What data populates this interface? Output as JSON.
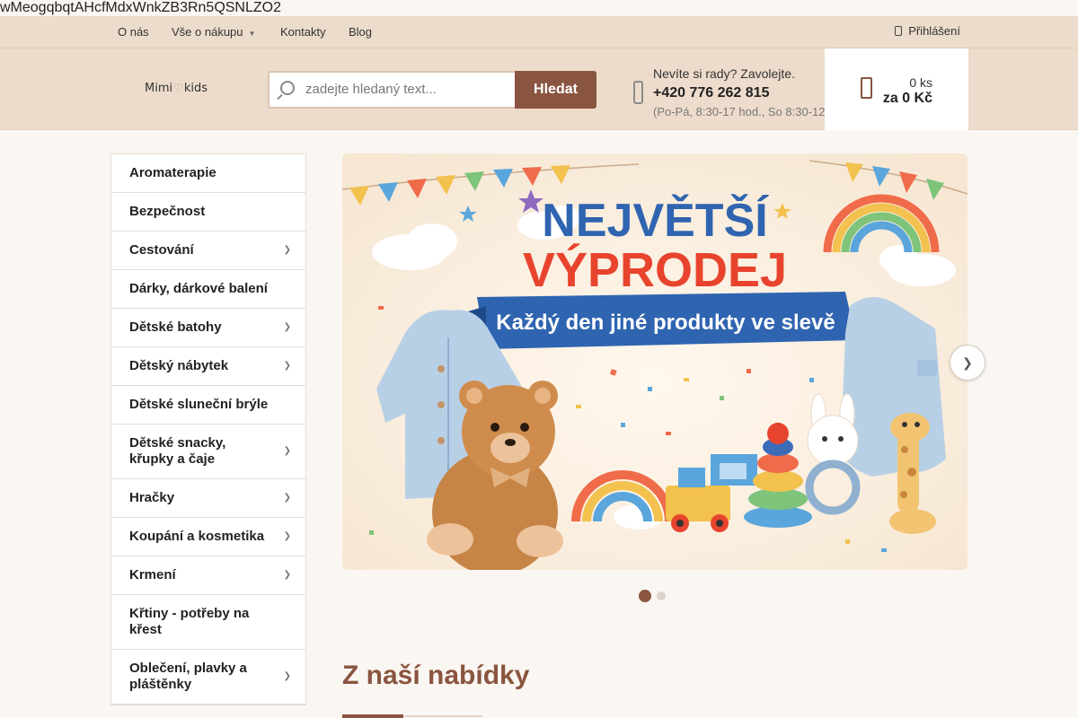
{
  "top_string": "wMeogqbqtAHcfMdxWnkZB3Rn5QSNLZO2",
  "topnav": {
    "items": [
      {
        "label": "O nás"
      },
      {
        "label": "Vše o nákupu",
        "has_dropdown": true
      },
      {
        "label": "Kontakty"
      },
      {
        "label": "Blog"
      }
    ],
    "login_label": "Přihlášení"
  },
  "header": {
    "logo_left": "Mimi",
    "logo_right": "kids",
    "search": {
      "placeholder": "zadejte hledaný text...",
      "button_label": "Hledat"
    },
    "contact": {
      "prompt": "Nevíte si rady? Zavolejte.",
      "phone": "+420 776 262 815",
      "hours": "(Po-Pá, 8:30-17 hod., So 8:30-12"
    },
    "cart": {
      "quantity": "0 ks",
      "total": "za 0 Kč"
    }
  },
  "categories": [
    {
      "label": "Aromaterapie",
      "has_submenu": false
    },
    {
      "label": "Bezpečnost",
      "has_submenu": false
    },
    {
      "label": "Cestování",
      "has_submenu": true
    },
    {
      "label": "Dárky, dárkové balení",
      "has_submenu": false
    },
    {
      "label": "Dětské batohy",
      "has_submenu": true
    },
    {
      "label": "Dětský nábytek",
      "has_submenu": true
    },
    {
      "label": "Dětské sluneční brýle",
      "has_submenu": false
    },
    {
      "label": "Dětské snacky, křupky a čaje",
      "has_submenu": true
    },
    {
      "label": "Hračky",
      "has_submenu": true
    },
    {
      "label": "Koupání a kosmetika",
      "has_submenu": true
    },
    {
      "label": "Krmení",
      "has_submenu": true
    },
    {
      "label": "Křtiny - potřeby na křest",
      "has_submenu": false
    },
    {
      "label": "Oblečení, plavky a pláštěnky",
      "has_submenu": true
    }
  ],
  "banner": {
    "headline_1": "NEJVĚTŠÍ",
    "headline_2": "VÝPRODEJ",
    "ribbon": "Každý den jiné produkty ve slevě",
    "slide_count": 2,
    "active_slide": 1
  },
  "section_title": "Z naší nabídky",
  "colors": {
    "accent": "#8a5540",
    "header_bg": "#eddccb",
    "page_bg": "#faf6f2"
  }
}
